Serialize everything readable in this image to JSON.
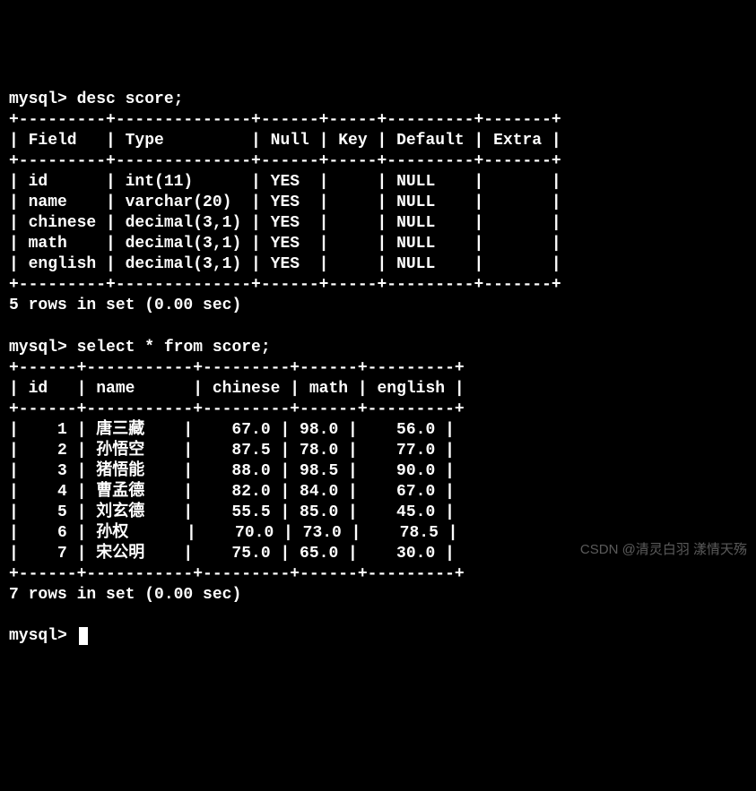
{
  "prompt": "mysql>",
  "commands": {
    "desc": "desc score;",
    "select": "select * from score;"
  },
  "desc_table": {
    "border_top": "+---------+--------------+------+-----+---------+-------+",
    "header": "| Field   | Type         | Null | Key | Default | Extra |",
    "border_mid": "+---------+--------------+------+-----+---------+-------+",
    "rows": [
      "| id      | int(11)      | YES  |     | NULL    |       |",
      "| name    | varchar(20)  | YES  |     | NULL    |       |",
      "| chinese | decimal(3,1) | YES  |     | NULL    |       |",
      "| math    | decimal(3,1) | YES  |     | NULL    |       |",
      "| english | decimal(3,1) | YES  |     | NULL    |       |"
    ],
    "border_bot": "+---------+--------------+------+-----+---------+-------+",
    "result": "5 rows in set (0.00 sec)"
  },
  "select_table": {
    "border_top": "+------+-----------+---------+------+---------+",
    "header": "| id   | name      | chinese | math | english |",
    "border_mid": "+------+-----------+---------+------+---------+",
    "rows": [
      "|    1 | 唐三藏    |    67.0 | 98.0 |    56.0 |",
      "|    2 | 孙悟空    |    87.5 | 78.0 |    77.0 |",
      "|    3 | 猪悟能    |    88.0 | 98.5 |    90.0 |",
      "|    4 | 曹孟德    |    82.0 | 84.0 |    67.0 |",
      "|    5 | 刘玄德    |    55.5 | 85.0 |    45.0 |",
      "|    6 | 孙权      |    70.0 | 73.0 |    78.5 |",
      "|    7 | 宋公明    |    75.0 | 65.0 |    30.0 |"
    ],
    "border_bot": "+------+-----------+---------+------+---------+",
    "result": "7 rows in set (0.00 sec)"
  },
  "chart_data": {
    "type": "table",
    "describe_result": {
      "columns": [
        "Field",
        "Type",
        "Null",
        "Key",
        "Default",
        "Extra"
      ],
      "rows": [
        {
          "Field": "id",
          "Type": "int(11)",
          "Null": "YES",
          "Key": "",
          "Default": "NULL",
          "Extra": ""
        },
        {
          "Field": "name",
          "Type": "varchar(20)",
          "Null": "YES",
          "Key": "",
          "Default": "NULL",
          "Extra": ""
        },
        {
          "Field": "chinese",
          "Type": "decimal(3,1)",
          "Null": "YES",
          "Key": "",
          "Default": "NULL",
          "Extra": ""
        },
        {
          "Field": "math",
          "Type": "decimal(3,1)",
          "Null": "YES",
          "Key": "",
          "Default": "NULL",
          "Extra": ""
        },
        {
          "Field": "english",
          "Type": "decimal(3,1)",
          "Null": "YES",
          "Key": "",
          "Default": "NULL",
          "Extra": ""
        }
      ]
    },
    "select_result": {
      "columns": [
        "id",
        "name",
        "chinese",
        "math",
        "english"
      ],
      "rows": [
        {
          "id": 1,
          "name": "唐三藏",
          "chinese": 67.0,
          "math": 98.0,
          "english": 56.0
        },
        {
          "id": 2,
          "name": "孙悟空",
          "chinese": 87.5,
          "math": 78.0,
          "english": 77.0
        },
        {
          "id": 3,
          "name": "猪悟能",
          "chinese": 88.0,
          "math": 98.5,
          "english": 90.0
        },
        {
          "id": 4,
          "name": "曹孟德",
          "chinese": 82.0,
          "math": 84.0,
          "english": 67.0
        },
        {
          "id": 5,
          "name": "刘玄德",
          "chinese": 55.5,
          "math": 85.0,
          "english": 45.0
        },
        {
          "id": 6,
          "name": "孙权",
          "chinese": 70.0,
          "math": 73.0,
          "english": 78.5
        },
        {
          "id": 7,
          "name": "宋公明",
          "chinese": 75.0,
          "math": 65.0,
          "english": 30.0
        }
      ]
    }
  },
  "watermark": "CSDN @清灵白羽 漾情天殇"
}
